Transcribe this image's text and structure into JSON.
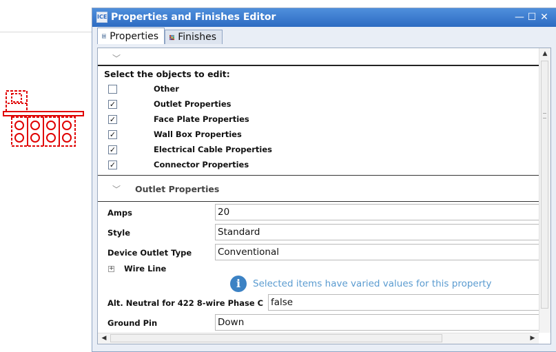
{
  "window": {
    "title": "Properties and Finishes Editor",
    "app_icon_text": "ICE",
    "controls": {
      "minimize": "—",
      "maximize": "☐",
      "close": "✕"
    }
  },
  "tabs": [
    {
      "label": "Properties",
      "active": true,
      "icon": "list-icon"
    },
    {
      "label": "Finishes",
      "active": false,
      "icon": "swatch-grid-icon"
    }
  ],
  "objects_section": {
    "title": "Select the objects to edit:",
    "items": [
      {
        "label": "Other",
        "checked": false
      },
      {
        "label": "Outlet Properties",
        "checked": true
      },
      {
        "label": "Face Plate Properties",
        "checked": true
      },
      {
        "label": "Wall Box Properties",
        "checked": true
      },
      {
        "label": "Electrical Cable Properties",
        "checked": true
      },
      {
        "label": "Connector Properties",
        "checked": true
      }
    ]
  },
  "outlet_section": {
    "title": "Outlet Properties",
    "properties": [
      {
        "label": "Amps",
        "value": "20"
      },
      {
        "label": "Style",
        "value": "Standard"
      },
      {
        "label": "Device Outlet Type",
        "value": "Conventional"
      }
    ],
    "wire_line": {
      "label": "Wire Line",
      "expander": "+"
    },
    "info_message": "Selected items have varied values for this property",
    "info_icon_glyph": "i",
    "more_properties": [
      {
        "label": "Alt. Neutral for 422 8-wire Phase C",
        "value": "false"
      },
      {
        "label": "Ground Pin",
        "value": "Down"
      }
    ]
  },
  "colors": {
    "titlebar": "#2d6bc2",
    "info_blue": "#3c82c4",
    "drawing_red": "#e00000"
  }
}
